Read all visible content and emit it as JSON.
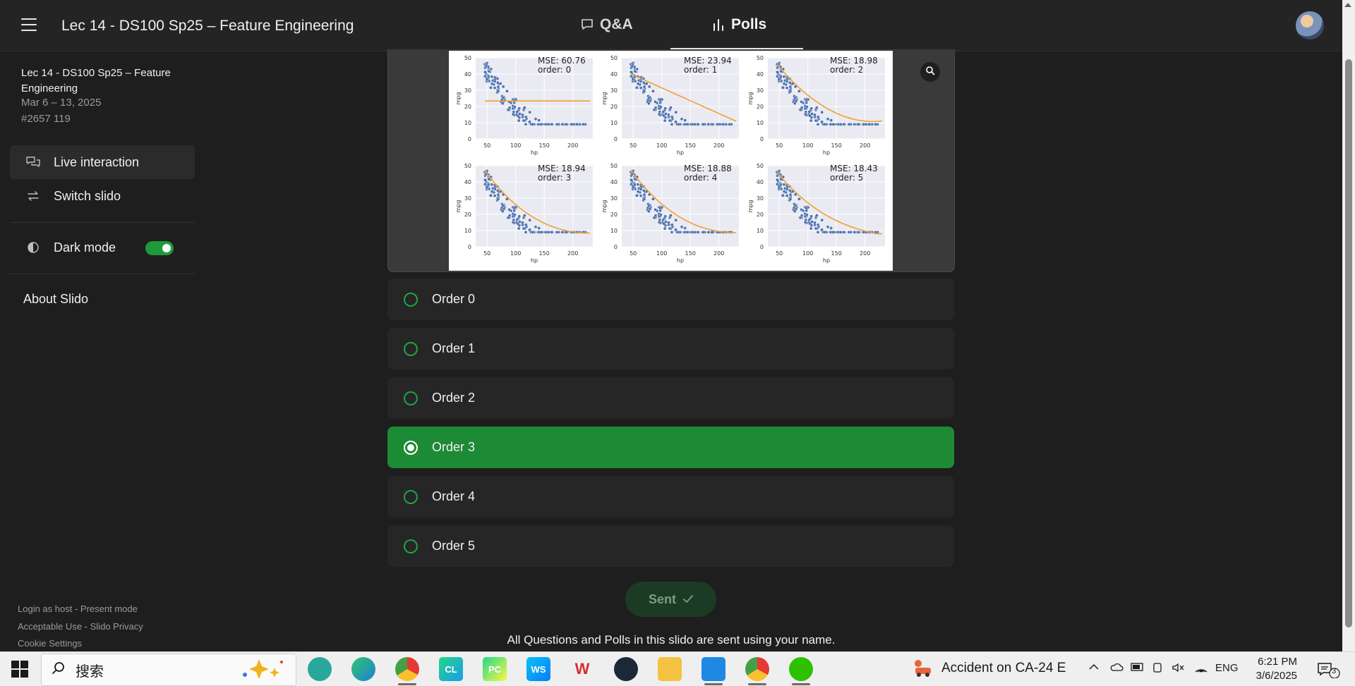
{
  "header": {
    "title": "Lec 14 - DS100 Sp25 – Feature Engineering",
    "tabs": [
      {
        "label": "Q&A",
        "icon": "chat-icon",
        "active": false
      },
      {
        "label": "Polls",
        "icon": "bar-chart-icon",
        "active": true
      }
    ]
  },
  "sidebar": {
    "event_name": "Lec 14 - DS100 Sp25 – Feature Engineering",
    "event_dates": "Mar 6 – 13, 2025",
    "event_code": "#2657 119",
    "items": [
      {
        "label": "Live interaction",
        "icon": "chat-bubbles-icon"
      },
      {
        "label": "Switch slido",
        "icon": "swap-arrows-icon"
      }
    ],
    "dark_mode": {
      "label": "Dark mode",
      "enabled": true
    },
    "about": "About Slido",
    "footer": {
      "login_host": "Login as host",
      "present_mode": "Present mode",
      "acceptable_use": "Acceptable Use",
      "privacy": "Slido Privacy",
      "cookie": "Cookie Settings",
      "separator": " - "
    }
  },
  "poll": {
    "figure": {
      "x_label": "hp",
      "y_label": "mpg",
      "x_ticks": [
        "50",
        "100",
        "150",
        "200"
      ],
      "y_ticks": [
        "0",
        "10",
        "20",
        "30",
        "40",
        "50"
      ],
      "panels": [
        {
          "mse": "MSE: 60.76",
          "order": "order: 0"
        },
        {
          "mse": "MSE: 23.94",
          "order": "order: 1"
        },
        {
          "mse": "MSE: 18.98",
          "order": "order: 2"
        },
        {
          "mse": "MSE: 18.94",
          "order": "order: 3"
        },
        {
          "mse": "MSE: 18.88",
          "order": "order: 4"
        },
        {
          "mse": "MSE: 18.43",
          "order": "order: 5"
        }
      ],
      "point_color": "#4c72b0",
      "line_color": "#f0a030"
    },
    "options": [
      {
        "label": "Order 0",
        "selected": false
      },
      {
        "label": "Order 1",
        "selected": false
      },
      {
        "label": "Order 2",
        "selected": false
      },
      {
        "label": "Order 3",
        "selected": true
      },
      {
        "label": "Order 4",
        "selected": false
      },
      {
        "label": "Order 5",
        "selected": false
      }
    ],
    "submit_label": "Sent",
    "notice": "All Questions and Polls in this slido are sent using your name."
  },
  "taskbar": {
    "search_placeholder": "搜索",
    "apps": [
      "copilot-icon",
      "brain-app-icon",
      "edge-icon",
      "chrome-icon",
      "clion-icon",
      "pycharm-icon",
      "webstorm-icon",
      "wps-icon",
      "steam-icon",
      "file-explorer-icon",
      "vscode-icon",
      "chrome-alt-icon",
      "wechat-icon"
    ],
    "news": "Accident on CA-24 E",
    "language": "ENG",
    "time": "6:21 PM",
    "date": "3/6/2025",
    "notification_count": "3"
  },
  "colors": {
    "accent_green": "#1d8a36",
    "background": "#1e1e1e"
  }
}
